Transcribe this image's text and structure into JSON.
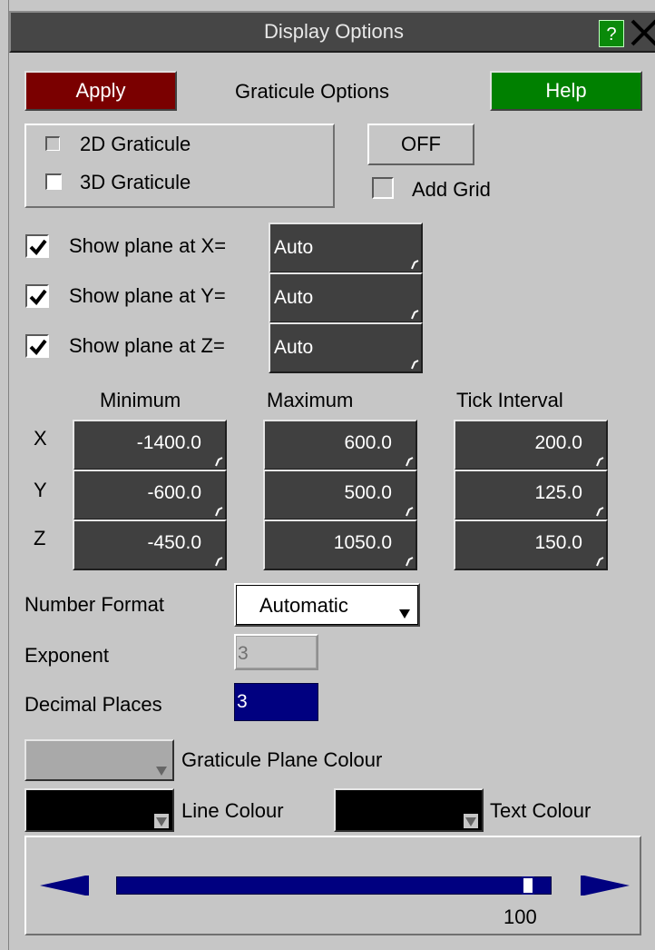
{
  "window": {
    "title": "Display Options",
    "help_glyph": "?",
    "close_glyph": "✕"
  },
  "toolbar": {
    "apply_label": "Apply",
    "section_title": "Graticule Options",
    "help_label": "Help"
  },
  "graticule_type": {
    "options": [
      "2D Graticule",
      "3D Graticule"
    ]
  },
  "off_button": "OFF",
  "add_grid_label": "Add Grid",
  "planes": [
    {
      "label": "Show plane at X=",
      "value": "Auto",
      "checked": true
    },
    {
      "label": "Show plane at Y=",
      "value": "Auto",
      "checked": true
    },
    {
      "label": "Show plane at Z=",
      "value": "Auto",
      "checked": true
    }
  ],
  "range_table": {
    "headers": [
      "Minimum",
      "Maximum",
      "Tick Interval"
    ],
    "rows": [
      {
        "axis": "X",
        "min": "-1400.0",
        "max": "600.0",
        "tick": "200.0"
      },
      {
        "axis": "Y",
        "min": "-600.0",
        "max": "500.0",
        "tick": "125.0"
      },
      {
        "axis": "Z",
        "min": "-450.0",
        "max": "1050.0",
        "tick": "150.0"
      }
    ]
  },
  "number_format": {
    "label": "Number Format",
    "value": "Automatic"
  },
  "exponent": {
    "label": "Exponent",
    "value": "3"
  },
  "decimal_places": {
    "label": "Decimal Places",
    "value": "3"
  },
  "colours": {
    "plane_label": "Graticule Plane Colour",
    "line_label": "Line Colour",
    "text_label": "Text Colour",
    "plane_colour": "#a9a9a9",
    "line_colour": "#000000",
    "text_colour": "#000000"
  },
  "slider": {
    "value": "100",
    "fraction": 0.96
  },
  "accent_colors": {
    "apply": "#7a0000",
    "help": "#008000",
    "field": "#404040",
    "selected": "#000080"
  }
}
